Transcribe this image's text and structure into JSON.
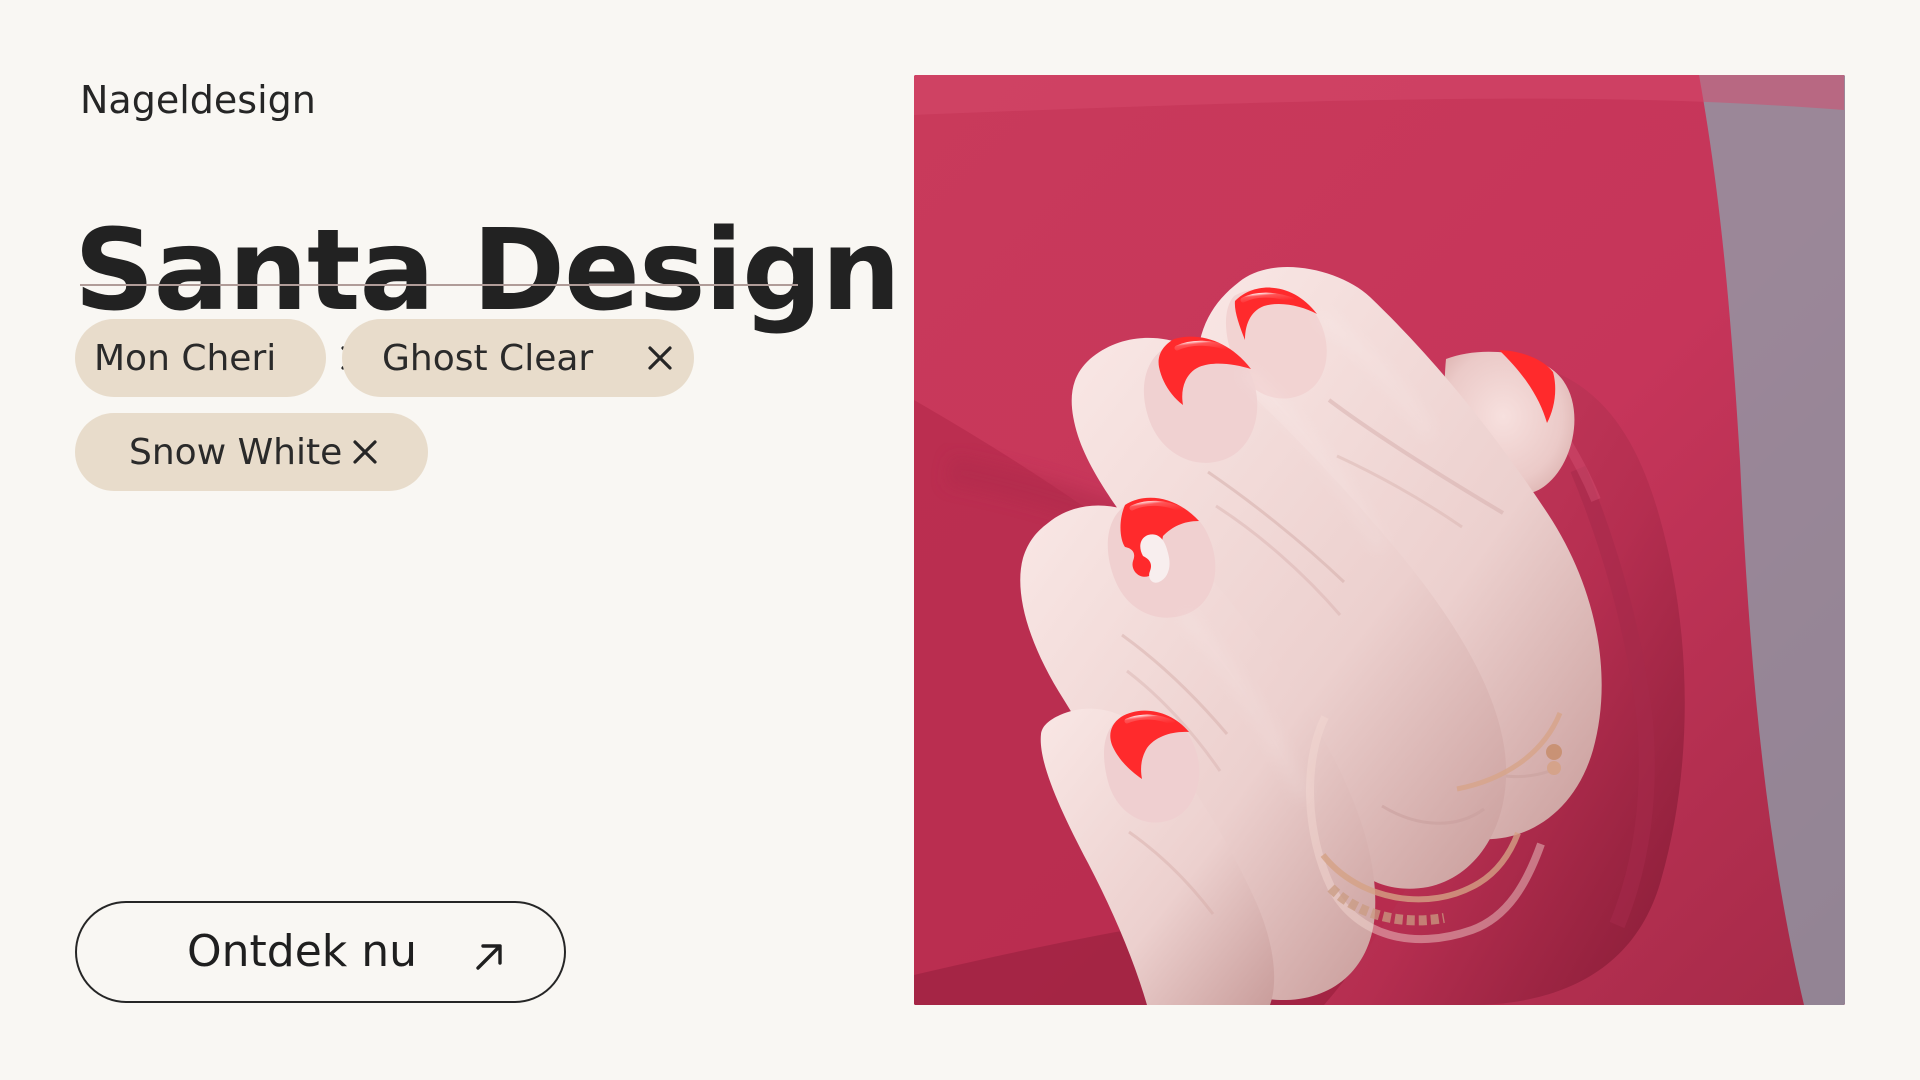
{
  "content": {
    "eyebrow": "Nageldesign",
    "title": "Santa Design"
  },
  "tags": [
    {
      "label": "Mon Cheri",
      "remove_icon": "close-icon"
    },
    {
      "label": "Ghost Clear",
      "remove_icon": "close-icon"
    },
    {
      "label": "Snow White",
      "remove_icon": "close-icon"
    }
  ],
  "cta": {
    "label": "Ontdek nu",
    "icon": "arrow-up-right-icon"
  },
  "image": {
    "subject": "manicured-hand-photo"
  },
  "colors": {
    "background": "#f9f7f3",
    "tag_background": "#e8dccb",
    "text": "#242424",
    "nail_red": "#ff2a2c",
    "sleeve": "#c03a56"
  }
}
